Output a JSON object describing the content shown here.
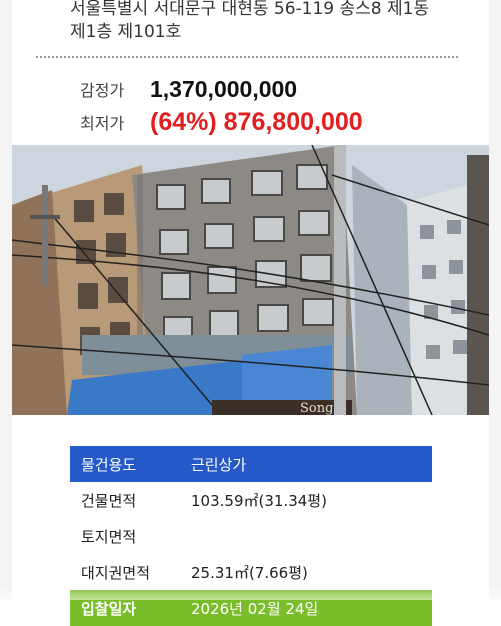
{
  "address": {
    "line1": "서울특별시 서대문구 대현동 56-119 송스8 제1동",
    "line2": "제1층 제101호"
  },
  "prices": {
    "appraisal_label": "감정가",
    "appraisal_value": "1,370,000,000",
    "minimum_label": "최저가",
    "minimum_value": "(64%) 876,800,000"
  },
  "photo": {
    "sign_text": "Songs"
  },
  "details": {
    "use_label": "물건용도",
    "use_value": "근린상가",
    "building_area_label": "건물면적",
    "building_area_value": "103.59㎡(31.34평)",
    "land_area_label": "토지면적",
    "land_area_value": "",
    "land_right_area_label": "대지권면적",
    "land_right_area_value": "25.31㎡(7.66평)",
    "sale_date_label": "입찰일자",
    "sale_date_value": "2026년 02월 24일"
  },
  "colors": {
    "accent_red": "#e31e1e",
    "header_blue": "#2459c7",
    "header_green": "#79bd2a"
  }
}
